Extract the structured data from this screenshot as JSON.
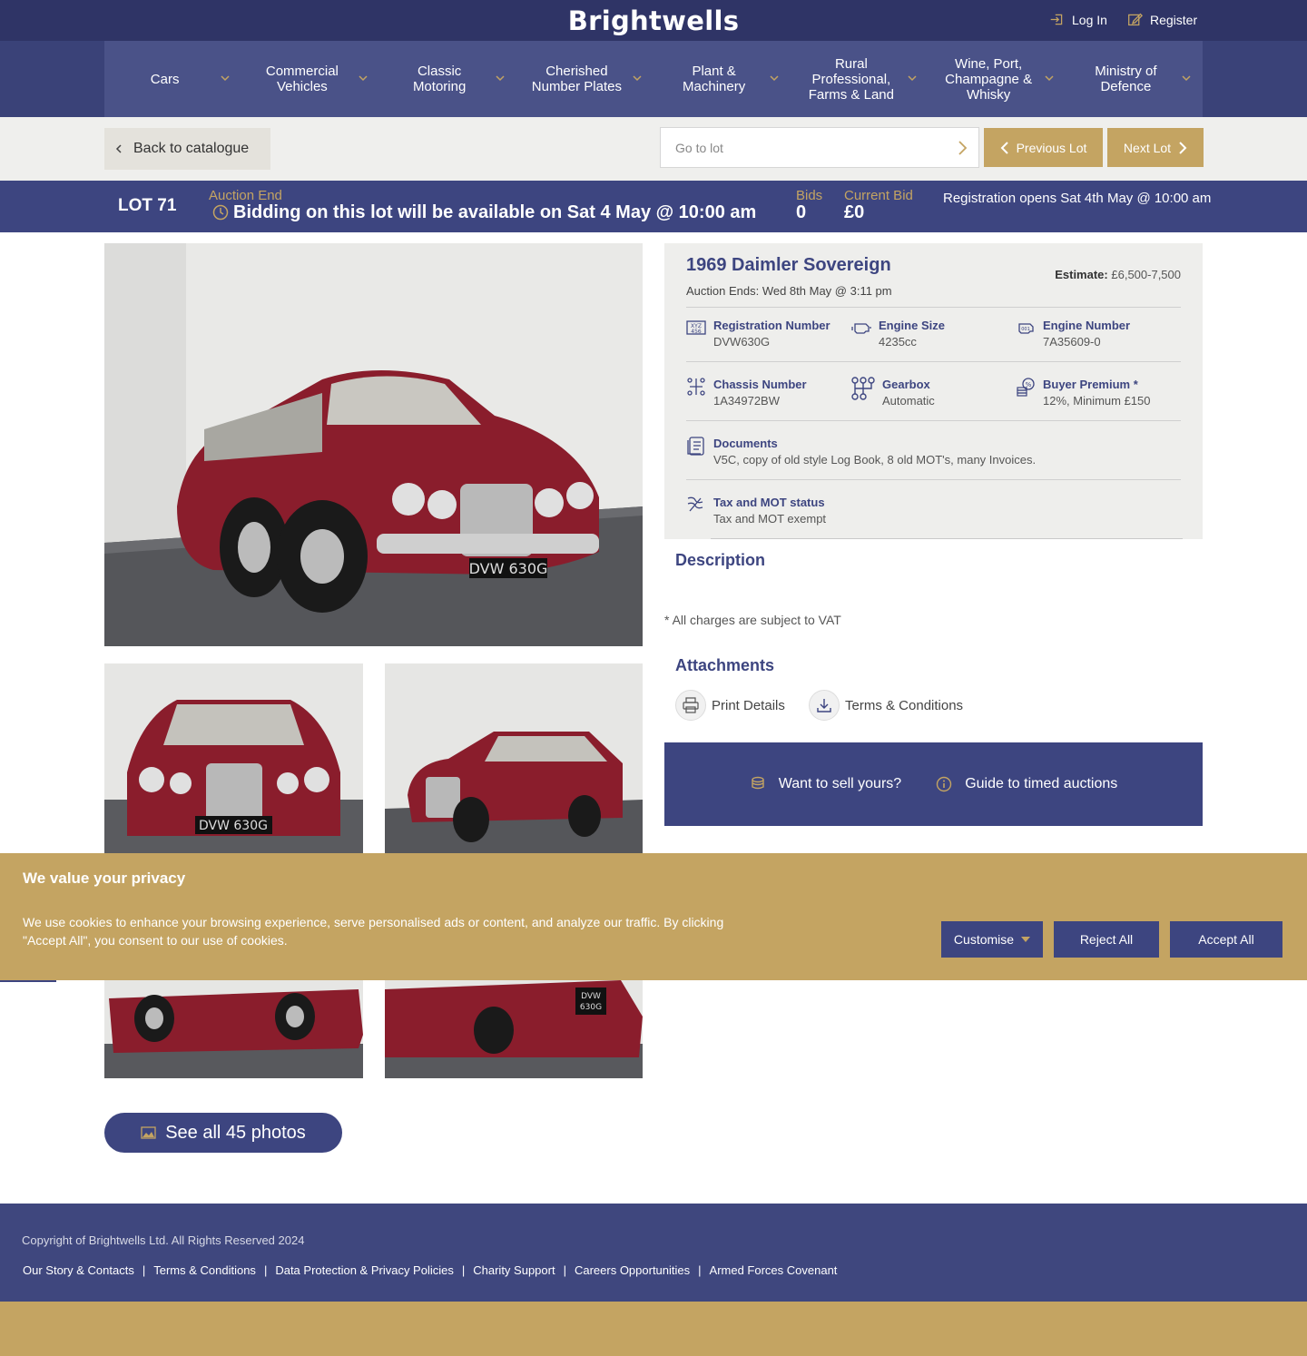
{
  "header": {
    "logo": "Brightwells",
    "login": "Log In",
    "register": "Register"
  },
  "nav": [
    {
      "label": "Cars"
    },
    {
      "label": "Commercial Vehicles"
    },
    {
      "label": "Classic Motoring"
    },
    {
      "label": "Cherished Number Plates"
    },
    {
      "label": "Plant & Machinery"
    },
    {
      "label": "Rural Professional, Farms & Land"
    },
    {
      "label": "Wine, Port, Champagne & Whisky"
    },
    {
      "label": "Ministry of Defence"
    }
  ],
  "catalogue": {
    "back": "Back to catalogue",
    "goto_placeholder": "Go to lot",
    "previous": "Previous Lot",
    "next": "Next Lot"
  },
  "lot_bar": {
    "lot": "LOT 71",
    "auction_end_label": "Auction End",
    "bidding_msg": "Bidding on this lot will be available on Sat 4 May @ 10:00 am",
    "bids_label": "Bids",
    "bids_value": "0",
    "current_bid_label": "Current Bid",
    "current_bid_value": "£0",
    "registration": "Registration opens Sat 4th May @ 10:00 am"
  },
  "details": {
    "title": "1969 Daimler Sovereign",
    "auction_ends": "Auction Ends: Wed 8th May @ 3:11 pm",
    "estimate_label": "Estimate:",
    "estimate_value": "£6,500-7,500",
    "specs": [
      {
        "label": "Registration Number",
        "value": "DVW630G",
        "icon": "registration-plate-icon"
      },
      {
        "label": "Engine Size",
        "value": "4235cc",
        "icon": "engine-icon"
      },
      {
        "label": "Engine Number",
        "value": "7A35609-0",
        "icon": "engine-number-icon"
      },
      {
        "label": "Chassis Number",
        "value": "1A34972BW",
        "icon": "chassis-icon"
      },
      {
        "label": "Gearbox",
        "value": "Automatic",
        "icon": "gearbox-icon"
      },
      {
        "label": "Buyer Premium *",
        "value": "12%, Minimum £150",
        "icon": "coins-icon"
      },
      {
        "label": "Documents",
        "value": "V5C, copy of old style Log Book, 8 old MOT's, many Invoices.",
        "icon": "document-icon"
      },
      {
        "label": "Tax and MOT status",
        "value": "Tax and MOT exempt",
        "icon": "tax-icon"
      }
    ]
  },
  "description_heading": "Description",
  "vat_note": "* All charges are subject to VAT",
  "attachments": {
    "heading": "Attachments",
    "print": "Print Details",
    "terms": "Terms & Conditions"
  },
  "sell_box": {
    "sell": "Want to sell yours?",
    "guide": "Guide to timed auctions"
  },
  "photos": {
    "see_all": "See all 45 photos"
  },
  "cookie": {
    "title": "We value your privacy",
    "text": "We use cookies to enhance your browsing experience, serve personalised ads or content, and analyze our traffic. By clicking \"Accept All\", you consent to our use of cookies.",
    "customise": "Customise",
    "reject": "Reject All",
    "accept": "Accept All"
  },
  "footer": {
    "copyright": "Copyright of Brightwells Ltd. All Rights Reserved 2024",
    "links": [
      "Our Story & Contacts",
      "Terms & Conditions",
      "Data Protection & Privacy Policies",
      "Charity Support",
      "Careers Opportunities",
      "Armed Forces Covenant"
    ]
  },
  "colors": {
    "navy": "#2f3466",
    "nav_blue": "#4a5288",
    "gold": "#c4a462",
    "car_red": "#8a1d2c"
  }
}
